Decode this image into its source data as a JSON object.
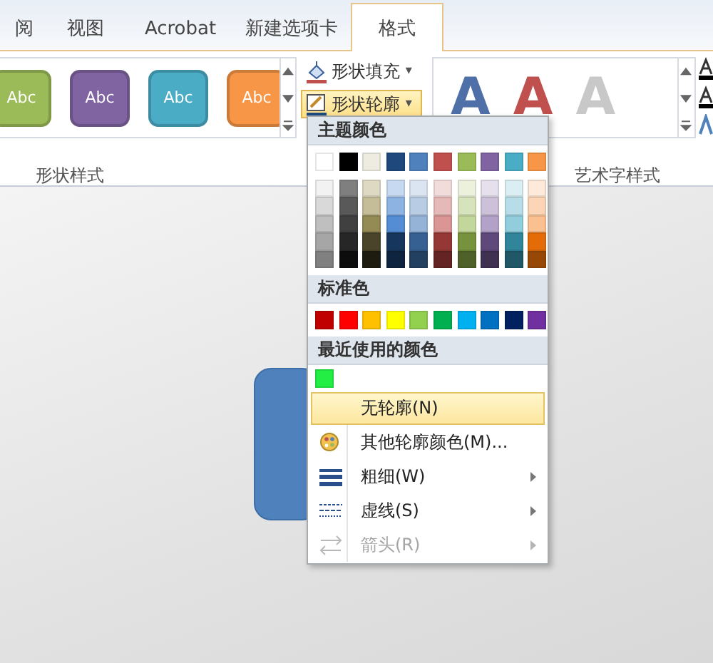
{
  "ribbon": {
    "tabs": [
      {
        "label": "阅",
        "selected": false
      },
      {
        "label": "视图",
        "selected": false
      },
      {
        "label": "Acrobat",
        "selected": false
      },
      {
        "label": "新建选项卡",
        "selected": false
      },
      {
        "label": "格式",
        "selected": true
      }
    ],
    "shape_styles": {
      "items": [
        {
          "label": "Abc",
          "color": "#9bbb59"
        },
        {
          "label": "Abc",
          "color": "#8064a2"
        },
        {
          "label": "Abc",
          "color": "#4bacc6"
        },
        {
          "label": "Abc",
          "color": "#f79646"
        }
      ],
      "group_label": "形状样式"
    },
    "shape_fill": {
      "label": "形状填充",
      "caret": "▾",
      "selected": false
    },
    "shape_outline": {
      "label": "形状轮廓",
      "caret": "▾",
      "selected": true
    },
    "wordart_styles": {
      "items": [
        {
          "label": "A",
          "color": "#4f6fa8"
        },
        {
          "label": "A",
          "color": "#c0504d"
        },
        {
          "label": "A",
          "color": "#c8c8c8"
        }
      ],
      "group_label": "艺术字样式"
    }
  },
  "menu": {
    "theme_title": "主题颜色",
    "theme_top": [
      {
        "color": "#ffffff"
      },
      {
        "color": "#000000"
      },
      {
        "color": "#eeece1"
      },
      {
        "color": "#1f497d"
      },
      {
        "color": "#4f81bd"
      },
      {
        "color": "#c0504d"
      },
      {
        "color": "#9bbb59"
      },
      {
        "color": "#8064a2"
      },
      {
        "color": "#4bacc6"
      },
      {
        "color": "#f79646"
      }
    ],
    "theme_shades": [
      [
        {
          "color": "#f2f2f2"
        },
        {
          "color": "#7f7f7f"
        },
        {
          "color": "#ddd9c3"
        },
        {
          "color": "#c6d9f0"
        },
        {
          "color": "#dbe5f1"
        },
        {
          "color": "#f2dcdb"
        },
        {
          "color": "#ebf1dd"
        },
        {
          "color": "#e5e0ec"
        },
        {
          "color": "#dbeef3"
        },
        {
          "color": "#fdeada"
        }
      ],
      [
        {
          "color": "#d9d9d9"
        },
        {
          "color": "#595959"
        },
        {
          "color": "#c4bd97"
        },
        {
          "color": "#8db3e2"
        },
        {
          "color": "#b8cce4"
        },
        {
          "color": "#e5b9b7"
        },
        {
          "color": "#d7e3bc"
        },
        {
          "color": "#ccc1d9"
        },
        {
          "color": "#b7dde8"
        },
        {
          "color": "#fbd5b5"
        }
      ],
      [
        {
          "color": "#bfbfbf"
        },
        {
          "color": "#404040"
        },
        {
          "color": "#948a54"
        },
        {
          "color": "#548dd4"
        },
        {
          "color": "#95b3d7"
        },
        {
          "color": "#d99694"
        },
        {
          "color": "#c3d69b"
        },
        {
          "color": "#b2a2c7"
        },
        {
          "color": "#92cddc"
        },
        {
          "color": "#fac08f"
        }
      ],
      [
        {
          "color": "#a6a6a6"
        },
        {
          "color": "#262626"
        },
        {
          "color": "#4a452a"
        },
        {
          "color": "#17365d"
        },
        {
          "color": "#366092"
        },
        {
          "color": "#953734"
        },
        {
          "color": "#76923c"
        },
        {
          "color": "#5f497a"
        },
        {
          "color": "#31859b"
        },
        {
          "color": "#e36c09"
        }
      ],
      [
        {
          "color": "#808080"
        },
        {
          "color": "#0d0d0d"
        },
        {
          "color": "#1e1c11"
        },
        {
          "color": "#0f243e"
        },
        {
          "color": "#244061"
        },
        {
          "color": "#632423"
        },
        {
          "color": "#4f6128"
        },
        {
          "color": "#3f3151"
        },
        {
          "color": "#205867"
        },
        {
          "color": "#974806"
        }
      ]
    ],
    "standard_title": "标准色",
    "standard": [
      {
        "color": "#c00000"
      },
      {
        "color": "#ff0000"
      },
      {
        "color": "#ffc000"
      },
      {
        "color": "#ffff00"
      },
      {
        "color": "#92d050"
      },
      {
        "color": "#00b050"
      },
      {
        "color": "#00b0f0"
      },
      {
        "color": "#0070c0"
      },
      {
        "color": "#002060"
      },
      {
        "color": "#7030a0"
      }
    ],
    "recent_title": "最近使用的颜色",
    "recent": [
      {
        "color": "#22ee44"
      }
    ],
    "items": [
      {
        "label": "无轮廓(N)",
        "kind": "none",
        "selected": true,
        "submenu": false,
        "disabled": false
      },
      {
        "label": "其他轮廓颜色(M)...",
        "kind": "palette",
        "selected": false,
        "submenu": false,
        "disabled": false
      },
      {
        "label": "粗细(W)",
        "kind": "weight",
        "selected": false,
        "submenu": true,
        "disabled": false
      },
      {
        "label": "虚线(S)",
        "kind": "dash",
        "selected": false,
        "submenu": true,
        "disabled": false
      },
      {
        "label": "箭头(R)",
        "kind": "arrow",
        "selected": false,
        "submenu": true,
        "disabled": true
      }
    ]
  },
  "canvas": {
    "shape": {
      "color": "#4f81bd"
    }
  }
}
